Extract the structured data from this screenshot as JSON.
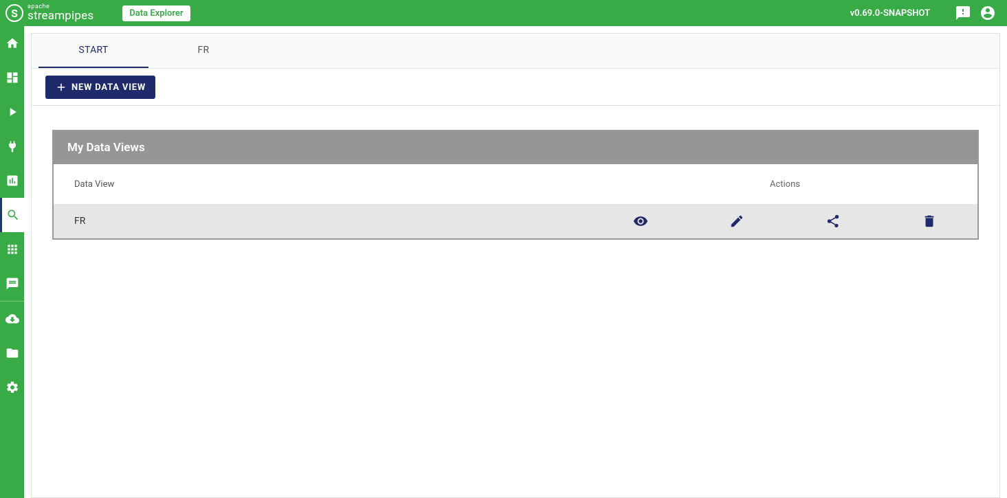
{
  "header": {
    "brand_top": "apache",
    "brand_name": "streampipes",
    "section_label": "Data Explorer",
    "version": "v0.69.0-SNAPSHOT"
  },
  "tabs": [
    {
      "label": "START",
      "active": true
    },
    {
      "label": "FR",
      "active": false
    }
  ],
  "toolbar": {
    "new_view_label": "NEW DATA VIEW"
  },
  "panel": {
    "title": "My Data Views",
    "columns": {
      "name": "Data View",
      "actions": "Actions"
    },
    "rows": [
      {
        "name": "FR"
      }
    ]
  }
}
